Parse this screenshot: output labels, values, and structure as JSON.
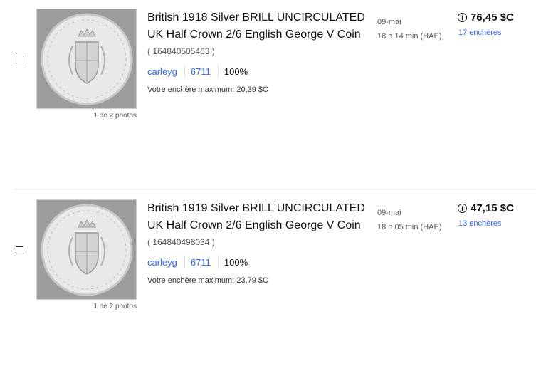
{
  "listings": [
    {
      "title": "British 1918 Silver BRILL UNCIRCULATED UK Half Crown 2/6 English George V Coin",
      "item_id": "( 164840505463 )",
      "photo_count": "1 de 2 photos",
      "seller": "carleyg",
      "feedback_score": "6711",
      "feedback_percent": "100%",
      "max_bid": "Votre enchère maximum: 20,39 $C",
      "end_date": "09-mai",
      "end_time": "18 h 14  min (HAE)",
      "price": "76,45 $C",
      "bids": "17 enchères",
      "info_icon_glyph": "i",
      "thumbnail_icon": "half-crown-coin-icon"
    },
    {
      "title": "British 1919 Silver BRILL UNCIRCULATED UK Half Crown 2/6 English George V Coin",
      "item_id": "( 164840498034 )",
      "photo_count": "1 de 2 photos",
      "seller": "carleyg",
      "feedback_score": "6711",
      "feedback_percent": "100%",
      "max_bid": "Votre enchère maximum: 23,79 $C",
      "end_date": "09-mai",
      "end_time": "18 h 05  min (HAE)",
      "price": "47,15 $C",
      "bids": "13 enchères",
      "info_icon_glyph": "i",
      "thumbnail_icon": "half-crown-coin-icon"
    }
  ],
  "colors": {
    "link": "#3665f3",
    "text": "#111111",
    "muted": "#555555"
  }
}
